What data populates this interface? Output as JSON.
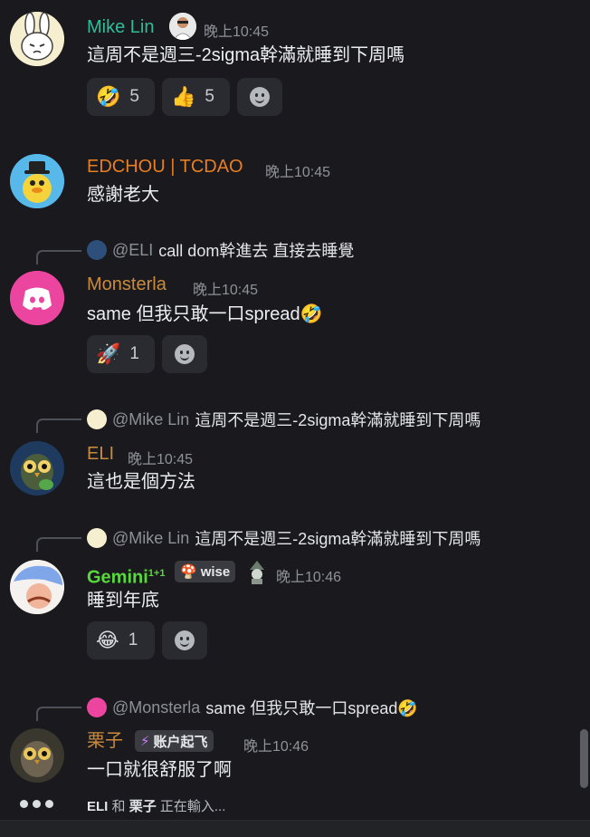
{
  "messages": [
    {
      "author": "Mike Lin",
      "author_color": "#2ebd9b",
      "time": "晚上10:45",
      "text": "這周不是週三-2sigma幹滿就睡到下周嗎",
      "reactions": [
        {
          "emoji": "🤣",
          "count": "5"
        },
        {
          "emoji": "👍",
          "count": "5"
        }
      ]
    },
    {
      "author": "EDCHOU | TCDAO",
      "author_color": "#e67e22",
      "time": "晚上10:45",
      "text": "感謝老大"
    },
    {
      "reply": {
        "mention": "@ELI",
        "text": "call dom幹進去 直接去睡覺"
      },
      "author": "Monsterla",
      "author_color": "#c98a3c",
      "time": "晚上10:45",
      "text": "same 但我只敢一口spread🤣",
      "reactions": [
        {
          "emoji": "🚀",
          "count": "1"
        }
      ]
    },
    {
      "reply": {
        "mention": "@Mike Lin",
        "text": "這周不是週三-2sigma幹滿就睡到下周嗎"
      },
      "author": "ELI",
      "author_color": "#c98a3c",
      "time": "晚上10:45",
      "text": "這也是個方法"
    },
    {
      "reply": {
        "mention": "@Mike Lin",
        "text": "這周不是週三-2sigma幹滿就睡到下周嗎"
      },
      "author": "Gemini",
      "author_sup": "1+1",
      "author_color": "#57d93b",
      "badge": {
        "icon": "🍄",
        "label": "wise"
      },
      "time": "晚上10:46",
      "text": "睡到年底",
      "reactions": [
        {
          "emoji": "😂",
          "count": "1"
        }
      ]
    },
    {
      "reply": {
        "mention": "@Monsterla",
        "text": "same 但我只敢一口spread🤣"
      },
      "author": "栗子",
      "author_color": "#c98a3c",
      "badge": {
        "icon": "⚡",
        "label": "账户起飞"
      },
      "time": "晚上10:46",
      "text": "一口就很舒服了啊"
    }
  ],
  "typing": {
    "user1": "ELI",
    "and": "和",
    "user2": "栗子",
    "suffix": "正在輸入..."
  },
  "icons": {
    "add_reaction": "smile-icon",
    "typing": "typing-dots-icon",
    "discord": "discord-logo-icon"
  }
}
